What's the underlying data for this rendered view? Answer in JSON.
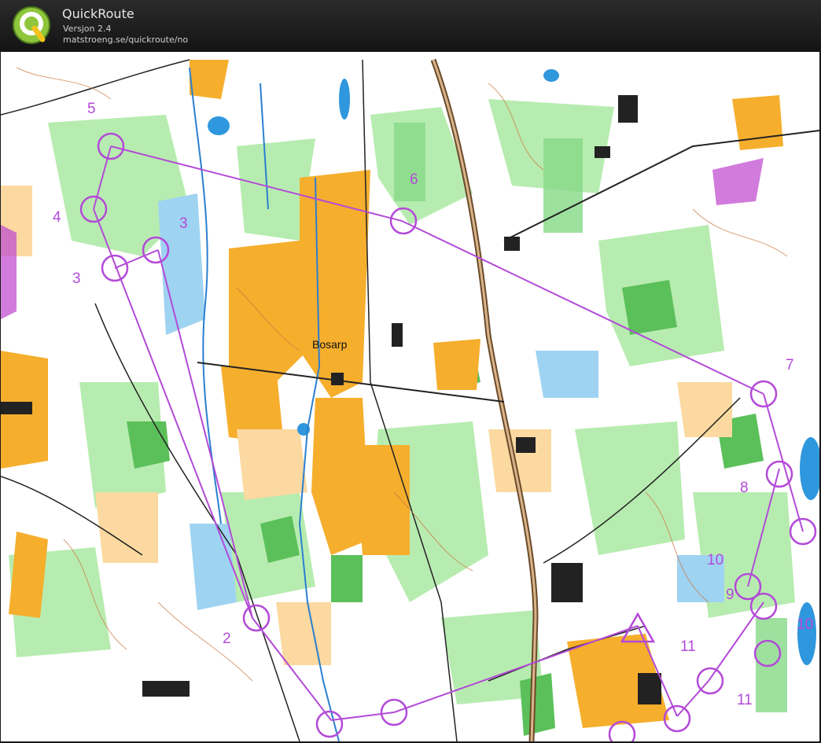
{
  "app": {
    "title": "QuickRoute",
    "version": "Versjon 2.4",
    "url": "matstroeng.se/quickroute/no"
  },
  "map": {
    "place_label": "Bosarp",
    "control_numbers": [
      "5",
      "4",
      "3",
      "3",
      "6",
      "7",
      "8",
      "10",
      "9",
      "10",
      "11",
      "11",
      "2"
    ],
    "colors": {
      "course": "#b34ad8",
      "open_land": "#f7b32b",
      "forest_green": "#9be39a",
      "water": "#3aa0e0",
      "road": "#7a5a3a"
    }
  }
}
